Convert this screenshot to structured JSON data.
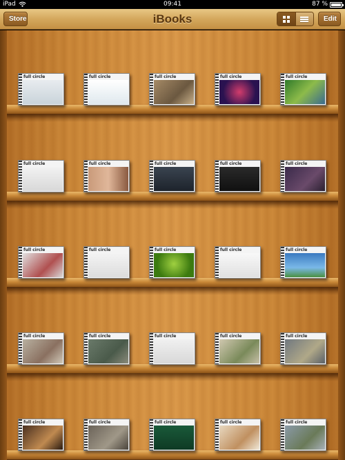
{
  "status_bar": {
    "device": "iPad",
    "time": "09:41",
    "battery": "87 %",
    "battery_level": 0.87
  },
  "toolbar": {
    "title": "iBooks",
    "store_label": "Store",
    "edit_label": "Edit",
    "view_mode_selected": "grid"
  },
  "colors": {
    "toolbar": "#d4a85d",
    "shelf_wood": "#c98536",
    "title_text": "#5a3710"
  },
  "shelves": [
    {
      "books": [
        {
          "logo": "full circle",
          "art": "linear-gradient(#e8ecef, #c9d3da)",
          "caption": ""
        },
        {
          "logo": "full circle",
          "art": "linear-gradient(#ffffff, #dfe8ee)",
          "caption": ""
        },
        {
          "logo": "full circle",
          "art": "linear-gradient(135deg, #a58a66, #6b5840 60%, #c8b08a)",
          "caption": ""
        },
        {
          "logo": "full circle",
          "art": "radial-gradient(circle at 50% 50%, #d23c6c, #2a1250 70%)",
          "caption": ""
        },
        {
          "logo": "full circle",
          "art": "linear-gradient(135deg, #2f7a2a, #8dbb4a 50%, #3a6a90)",
          "caption": ""
        }
      ]
    },
    {
      "books": [
        {
          "logo": "full circle",
          "art": "linear-gradient(#f2f2f2, #d8d8d8)",
          "caption": ""
        },
        {
          "logo": "full circle",
          "art": "linear-gradient(90deg, #c99a7a, #e0b79a 50%, #8a5a40)",
          "caption": ""
        },
        {
          "logo": "full circle",
          "art": "linear-gradient(#3a4450, #1d232b)",
          "caption": ""
        },
        {
          "logo": "full circle",
          "art": "linear-gradient(#2a2a2a, #101010)",
          "caption": ""
        },
        {
          "logo": "full circle",
          "art": "linear-gradient(135deg, #3a2a4a, #6a4a6a 60%, #2a2030)",
          "caption": ""
        }
      ]
    },
    {
      "books": [
        {
          "logo": "full circle",
          "art": "linear-gradient(135deg, #e0e0e0, #b05050 60%, #d8d8d8)",
          "caption": ""
        },
        {
          "logo": "full circle",
          "art": "linear-gradient(#f4f4f4, #dcdcdc)",
          "caption": ""
        },
        {
          "logo": "full circle",
          "art": "radial-gradient(circle at 50% 45%, #9fd040, #3c7a10 70%)",
          "caption": ""
        },
        {
          "logo": "full circle",
          "art": "linear-gradient(#f8f8f8, #e0e0e0)",
          "caption": ""
        },
        {
          "logo": "full circle",
          "art": "linear-gradient(#3a7ac0, #7ab8e8 60%, #4a9040)",
          "caption": ""
        }
      ]
    },
    {
      "books": [
        {
          "logo": "full circle",
          "art": "linear-gradient(135deg, #b8b0a0, #8a7060 60%, #d0c8b8)",
          "caption": ""
        },
        {
          "logo": "full circle",
          "art": "linear-gradient(135deg, #6a7a6a, #4a5a4a 60%, #8a8a7a)",
          "caption": ""
        },
        {
          "logo": "full circle",
          "art": "linear-gradient(#f0f0f0, #d8d8d8)",
          "caption": ""
        },
        {
          "logo": "full circle",
          "art": "linear-gradient(135deg, #d0c8b0, #7a8a5a 60%, #c8c0a8)",
          "caption": ""
        },
        {
          "logo": "full circle",
          "art": "linear-gradient(135deg, #707880, #b0a888 60%, #5a6068)",
          "caption": ""
        }
      ]
    },
    {
      "books": [
        {
          "logo": "full circle",
          "art": "linear-gradient(135deg, #4a3020, #c08a50 60%, #2a1a10)",
          "caption": ""
        },
        {
          "logo": "full circle",
          "art": "linear-gradient(135deg, #6a6258, #a09888 60%, #4a443c)",
          "caption": ""
        },
        {
          "logo": "full circle",
          "art": "linear-gradient(#1a5a3a, #0e3a24)",
          "caption": ""
        },
        {
          "logo": "full circle",
          "art": "linear-gradient(135deg, #e8d8c0, #c09060 60%, #f0e8d8)",
          "caption": ""
        },
        {
          "logo": "full circle",
          "art": "linear-gradient(135deg, #8a9aa8, #6a7a58 60%, #a8b0b8)",
          "caption": ""
        }
      ]
    }
  ]
}
